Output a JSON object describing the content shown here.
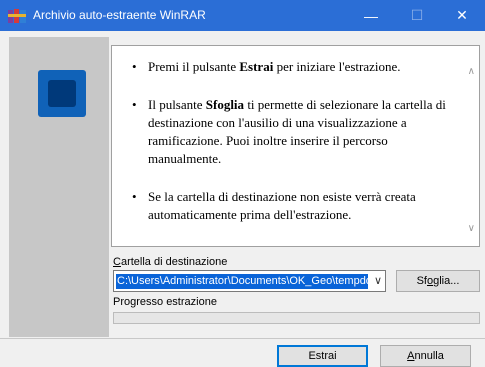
{
  "window": {
    "title": "Archivio auto-estraente WinRAR",
    "controls": {
      "minimize": "—",
      "maximize": "☐",
      "close": "✕"
    }
  },
  "instructions": {
    "items": [
      {
        "before": "Premi il pulsante ",
        "bold": "Estrai",
        "after": " per iniziare l'estrazione."
      },
      {
        "before": "Il pulsante ",
        "bold": "Sfoglia",
        "after": " ti permette di selezionare la cartella di destinazione con l'ausilio di una visualizzazione a ramificazione. Puoi inoltre inserire il percorso manualmente."
      },
      {
        "before": "",
        "bold": "",
        "after": "Se la cartella di destinazione non esiste verrà creata automaticamente prima dell'estrazione."
      }
    ]
  },
  "destination": {
    "label_underlined": "C",
    "label_rest": "artella di destinazione",
    "value": "C:\\Users\\Administrator\\Documents\\OK_Geo\\tempdocfa"
  },
  "progress": {
    "label": "Progresso estrazione",
    "value": 0
  },
  "buttons": {
    "browse_pre": "Sf",
    "browse_underlined": "o",
    "browse_post": "glia...",
    "extract": "Estrai",
    "cancel_underlined": "A",
    "cancel_rest": "nnulla"
  },
  "colors": {
    "titlebar": "#2b6ed6",
    "logo_outer": "#1062b8",
    "logo_inner": "#00397a",
    "selection": "#0a64d8"
  },
  "icons": {
    "app": "winrar-books-icon",
    "logo": "square-logo-icon",
    "scroll_up": "chevron-up-icon",
    "scroll_down": "chevron-down-icon",
    "combo_dropdown": "chevron-down-icon"
  }
}
